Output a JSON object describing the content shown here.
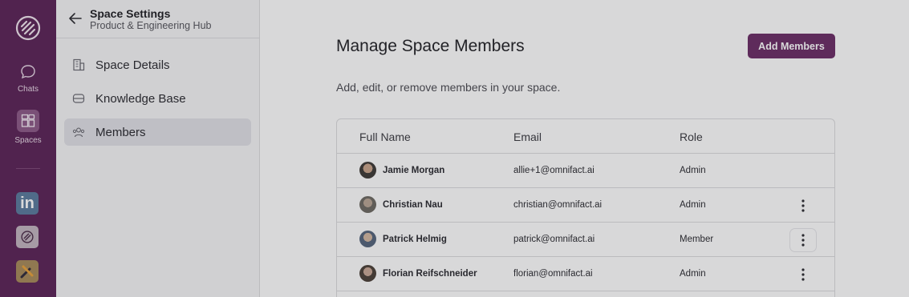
{
  "rail": {
    "chats_label": "Chats",
    "spaces_label": "Spaces",
    "apps": [
      "linkedin-icon",
      "omnifact-icon",
      "tools-icon"
    ],
    "linkedin_text": "in"
  },
  "sidebar": {
    "title": "Space Settings",
    "subtitle": "Product & Engineering Hub",
    "items": [
      {
        "label": "Space Details",
        "icon": "building-icon"
      },
      {
        "label": "Knowledge Base",
        "icon": "database-icon"
      },
      {
        "label": "Members",
        "icon": "users-icon",
        "active": true
      }
    ]
  },
  "main": {
    "title": "Manage Space Members",
    "add_button": "Add Members",
    "description": "Add, edit, or remove members in your space.",
    "table": {
      "headers": [
        "Full Name",
        "Email",
        "Role"
      ],
      "rows": [
        {
          "name": "Jamie Morgan",
          "email": "allie+1@omnifact.ai",
          "role": "Admin",
          "menu": false
        },
        {
          "name": "Christian Nau",
          "email": "christian@omnifact.ai",
          "role": "Admin",
          "menu": true
        },
        {
          "name": "Patrick Helmig",
          "email": "patrick@omnifact.ai",
          "role": "Member",
          "menu": true,
          "menu_focused": true
        },
        {
          "name": "Florian Reifschneider",
          "email": "florian@omnifact.ai",
          "role": "Admin",
          "menu": true
        }
      ]
    }
  },
  "colors": {
    "rail_bg": "#5b2357",
    "accent": "#6b2c66"
  }
}
